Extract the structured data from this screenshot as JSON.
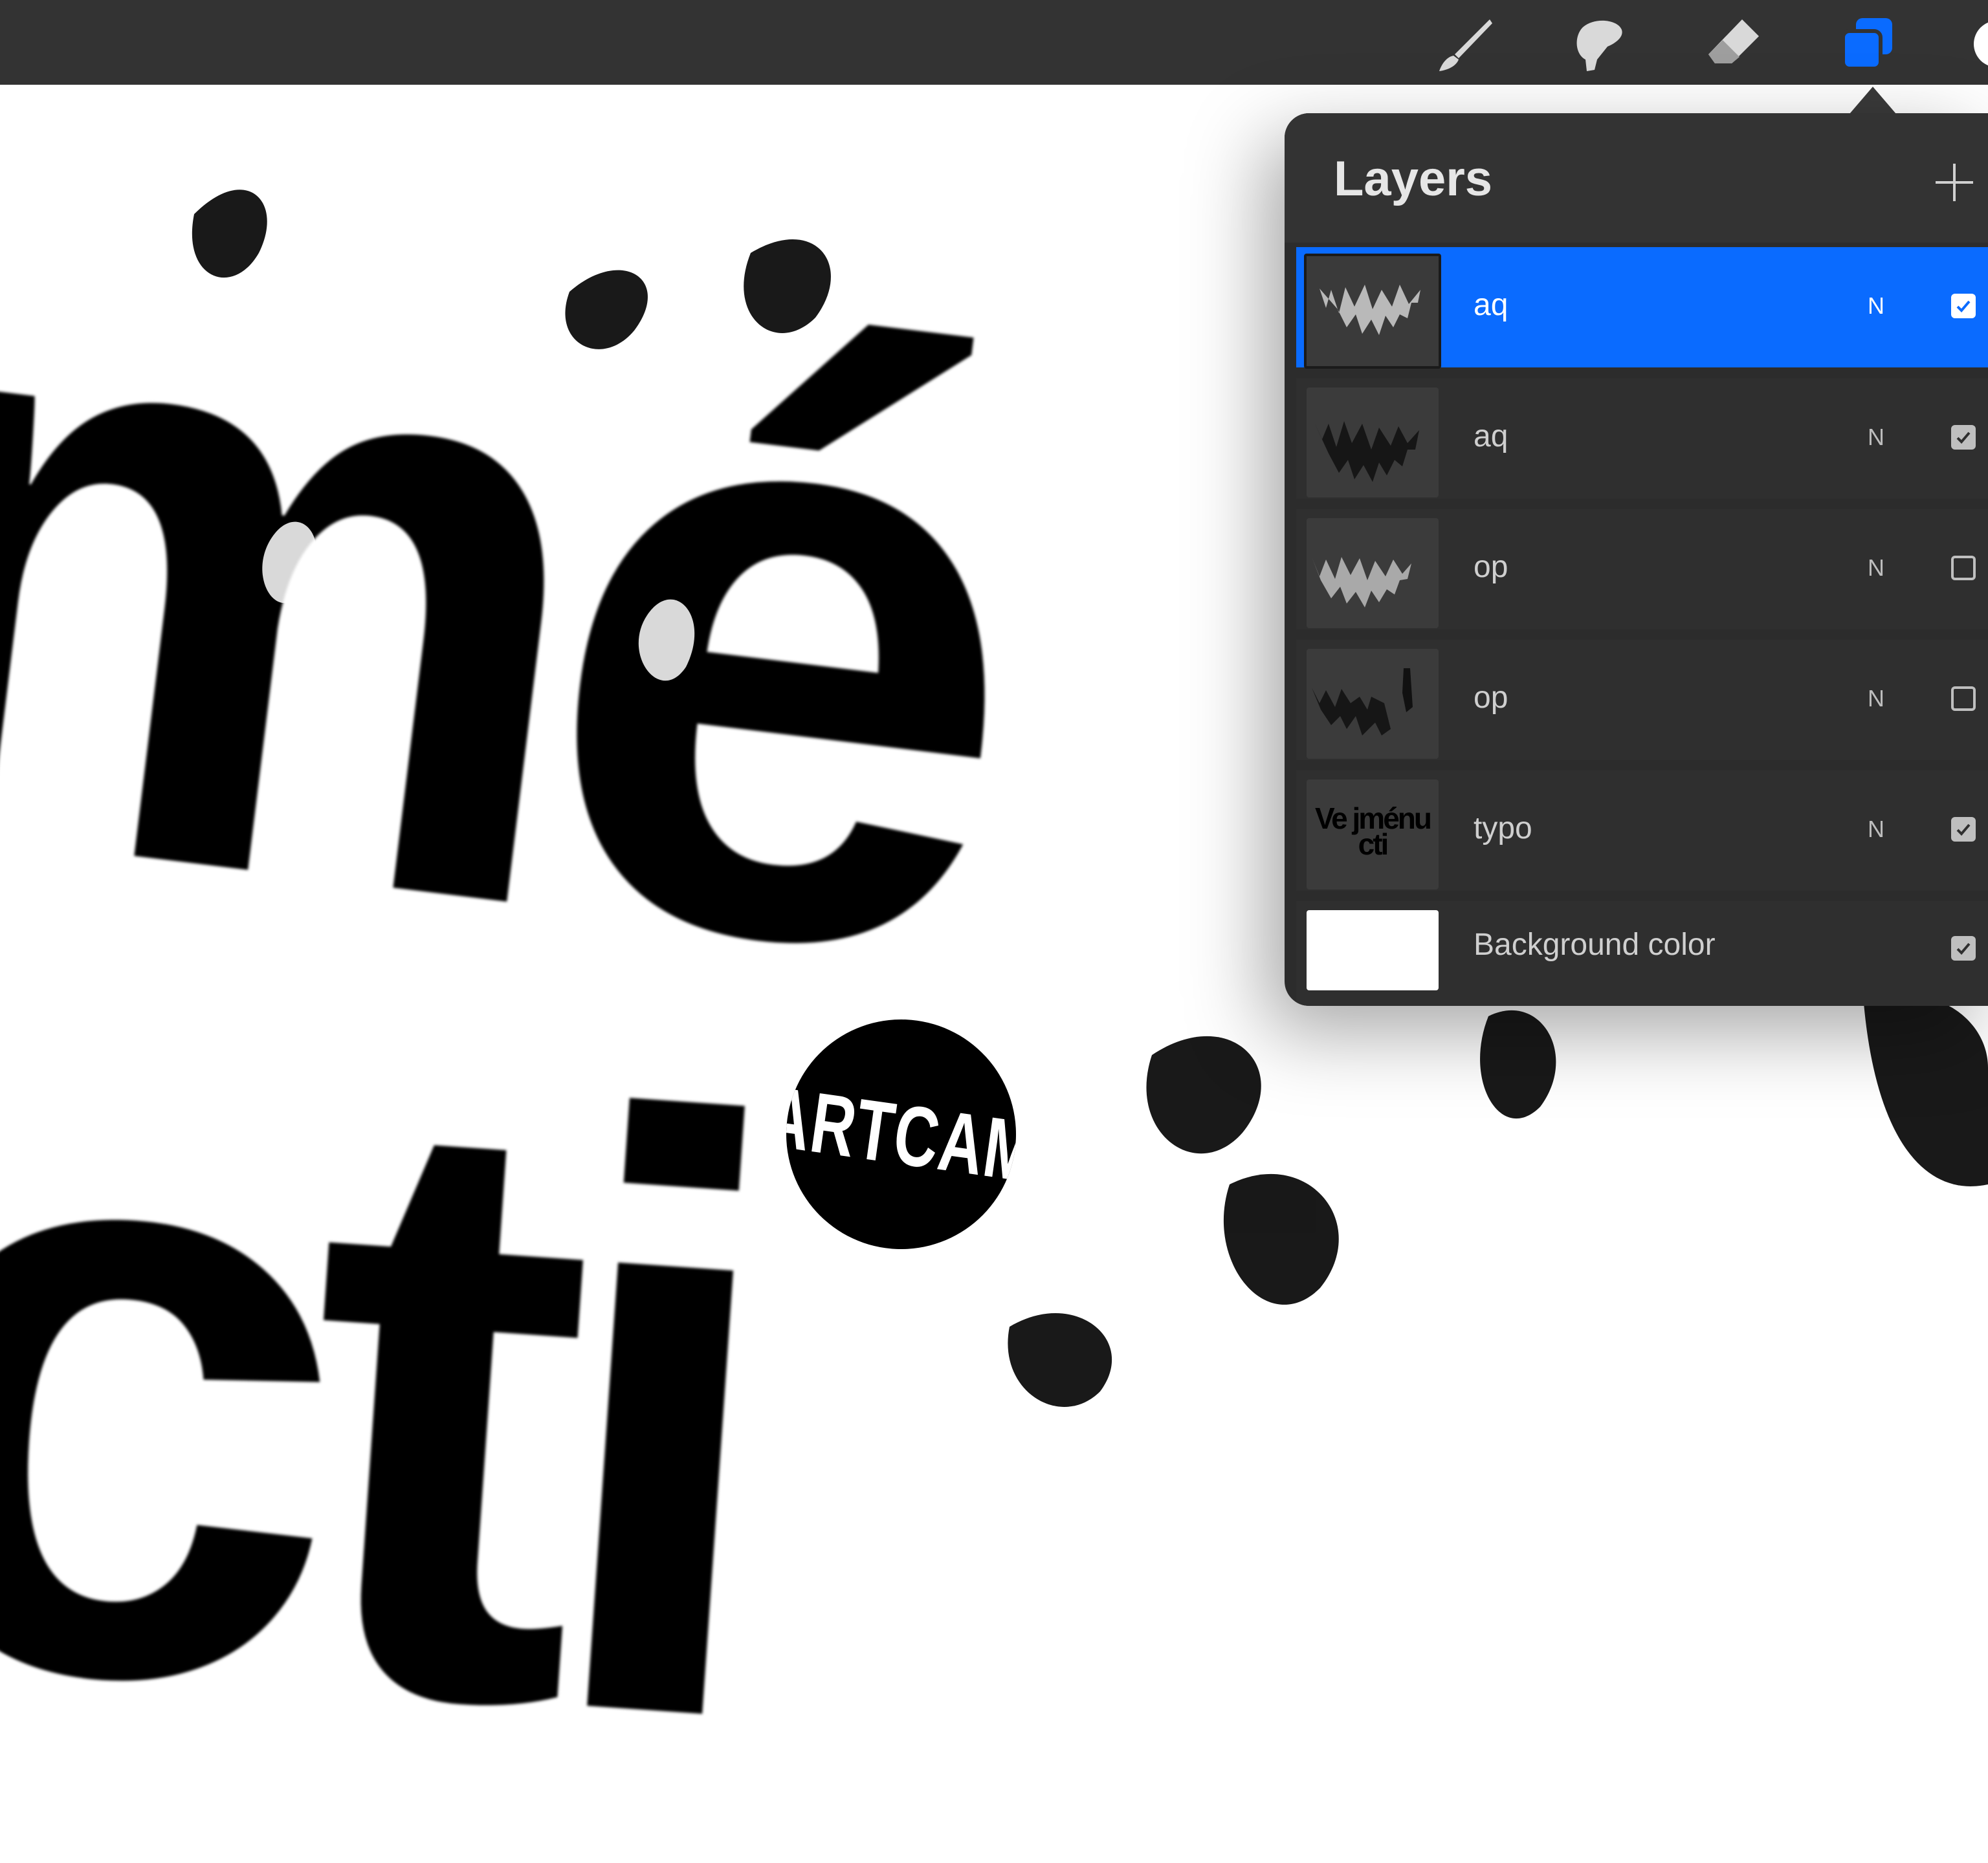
{
  "toolbar": {
    "tools": [
      {
        "name": "brush",
        "icon": "brush-icon",
        "active": false
      },
      {
        "name": "smudge",
        "icon": "smudge-icon",
        "active": false
      },
      {
        "name": "eraser",
        "icon": "eraser-icon",
        "active": false
      },
      {
        "name": "layers",
        "icon": "layers-icon",
        "active": true
      },
      {
        "name": "color",
        "icon": "color-swatch-icon",
        "active": false
      }
    ],
    "active_color": "#0a6bff"
  },
  "canvas": {
    "word_top": "mé",
    "word_bottom": "cti",
    "badge_text": "ARTCAM"
  },
  "layers_panel": {
    "title": "Layers",
    "add_icon": "plus-icon",
    "layers": [
      {
        "name": "aq",
        "blend": "N",
        "visible": true,
        "selected": true
      },
      {
        "name": "aq",
        "blend": "N",
        "visible": true,
        "selected": false
      },
      {
        "name": "op",
        "blend": "N",
        "visible": false,
        "selected": false
      },
      {
        "name": "op",
        "blend": "N",
        "visible": false,
        "selected": false
      },
      {
        "name": "typo",
        "blend": "N",
        "visible": true,
        "selected": false,
        "thumb_text": "Ve jménu cti"
      },
      {
        "name": "Background color",
        "blend": "",
        "visible": true,
        "selected": false
      }
    ]
  }
}
